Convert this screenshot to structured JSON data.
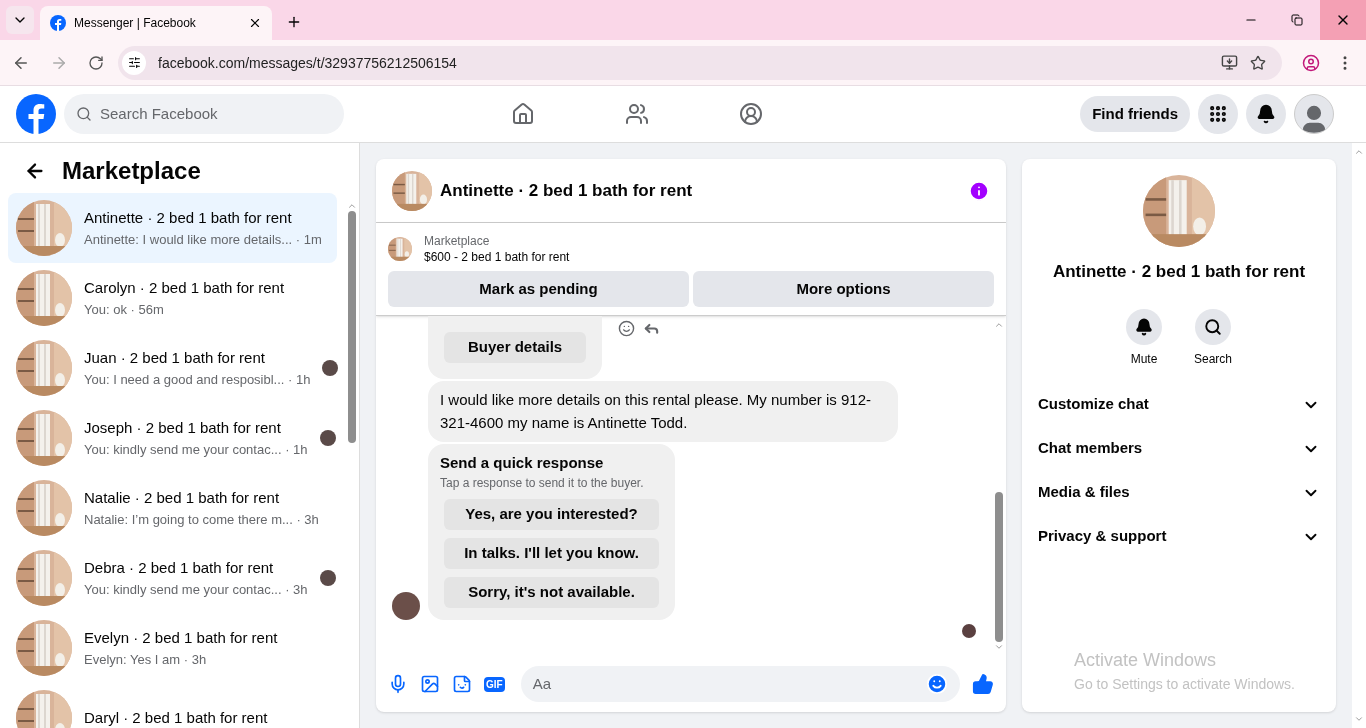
{
  "browser": {
    "tab_title": "Messenger | Facebook",
    "url": "facebook.com/messages/t/32937756212506154"
  },
  "header": {
    "search_placeholder": "Search Facebook",
    "find_friends": "Find friends"
  },
  "sidebar": {
    "title": "Marketplace",
    "conversations": [
      {
        "name": "Antinette · 2 bed 1 bath for rent",
        "preview": "Antinette: I would like more details... · 1m",
        "selected": true,
        "read_receipt": false
      },
      {
        "name": "Carolyn · 2 bed 1 bath for rent",
        "preview": "You: ok · 56m",
        "selected": false,
        "read_receipt": false
      },
      {
        "name": "Juan · 2 bed 1 bath for rent",
        "preview": "You: I need a good and resposibl... · 1h",
        "selected": false,
        "read_receipt": true
      },
      {
        "name": "Joseph · 2 bed 1 bath for rent",
        "preview": "You: kindly send me your contac... · 1h",
        "selected": false,
        "read_receipt": true
      },
      {
        "name": "Natalie · 2 bed 1 bath for rent",
        "preview": "Natalie: I’m going to come there m... · 3h",
        "selected": false,
        "read_receipt": false
      },
      {
        "name": "Debra · 2 bed 1 bath for rent",
        "preview": "You: kindly send me your contac... · 3h",
        "selected": false,
        "read_receipt": true
      },
      {
        "name": "Evelyn · 2 bed 1 bath for rent",
        "preview": "Evelyn: Yes I am · 3h",
        "selected": false,
        "read_receipt": false
      },
      {
        "name": "Daryl · 2 bed 1 bath for rent",
        "selected": false,
        "read_receipt": false
      }
    ]
  },
  "chat": {
    "title": "Antinette · 2 bed 1 bath for rent",
    "listing_label": "Marketplace",
    "listing": "$600 - 2 bed 1 bath for rent",
    "actions": [
      "Mark as pending",
      "More options"
    ],
    "buyer_details": "Buyer details",
    "message": "I would like more details on this rental please. My number is 912-321-4600 my name is Antinette Todd.",
    "quick_response": {
      "title": "Send a quick response",
      "subtitle": "Tap a response to send it to the buyer.",
      "options": [
        "Yes, are you interested?",
        "In talks. I'll let you know.",
        "Sorry, it's not available."
      ]
    },
    "gif_label": "GIF",
    "composer_placeholder": "Aa"
  },
  "details": {
    "name": "Antinette · 2 bed 1 bath for rent",
    "actions": [
      {
        "label": "Mute",
        "kind": "bell"
      },
      {
        "label": "Search",
        "kind": "search"
      }
    ],
    "sections": [
      {
        "label": "Customize chat",
        "expanded": false
      },
      {
        "label": "Chat members",
        "expanded": false
      },
      {
        "label": "Media & files",
        "expanded": false
      },
      {
        "label": "Privacy & support",
        "expanded": false
      }
    ]
  },
  "os_notice": {
    "title": "Activate Windows",
    "subtitle": "Go to Settings to activate Windows."
  }
}
